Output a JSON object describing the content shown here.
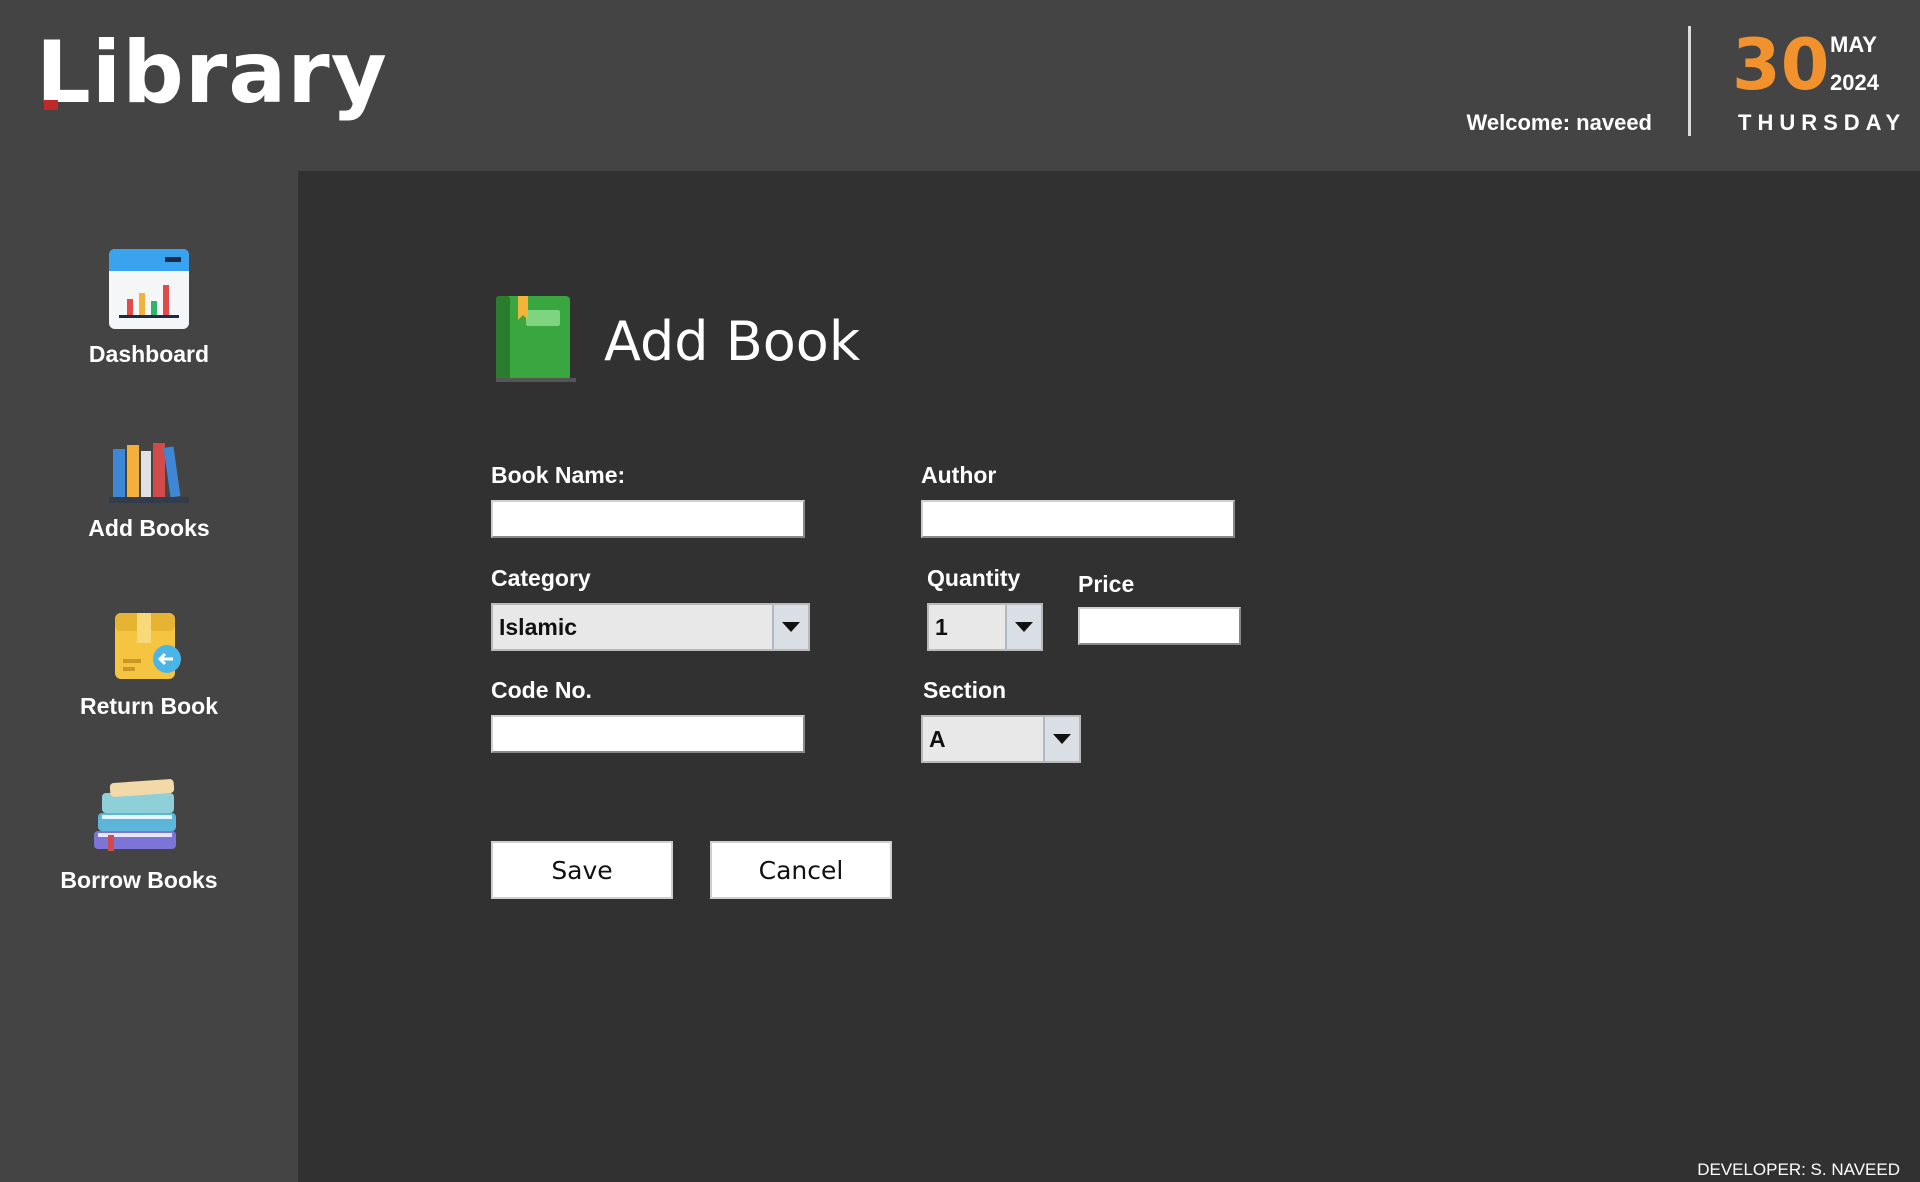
{
  "header": {
    "logo": "Library",
    "welcome": "Welcome: naveed",
    "date": {
      "day": "30",
      "month": "MAY",
      "year": "2024",
      "weekday": "THURSDAY"
    }
  },
  "sidebar": {
    "items": [
      {
        "label": "Dashboard",
        "icon": "dashboard-chart-icon"
      },
      {
        "label": "Add Books",
        "icon": "books-shelf-icon"
      },
      {
        "label": "Return Book",
        "icon": "return-box-icon"
      },
      {
        "label": "Borrow Books",
        "icon": "book-stack-icon"
      }
    ]
  },
  "form": {
    "title": "Add Book",
    "title_icon": "green-book-icon",
    "book_name": {
      "label": "Book Name:",
      "value": ""
    },
    "author": {
      "label": "Author",
      "value": ""
    },
    "category": {
      "label": "Category",
      "value": "Islamic"
    },
    "quantity": {
      "label": "Quantity",
      "value": "1"
    },
    "price": {
      "label": "Price",
      "value": ""
    },
    "code_no": {
      "label": "Code No.",
      "value": ""
    },
    "section": {
      "label": "Section",
      "value": "A"
    },
    "save_label": "Save",
    "cancel_label": "Cancel"
  },
  "footer": {
    "developer": "DEVELOPER: S. NAVEED"
  },
  "colors": {
    "accent_date": "#f2922d",
    "header_bg": "#444444",
    "main_bg": "#313131"
  }
}
